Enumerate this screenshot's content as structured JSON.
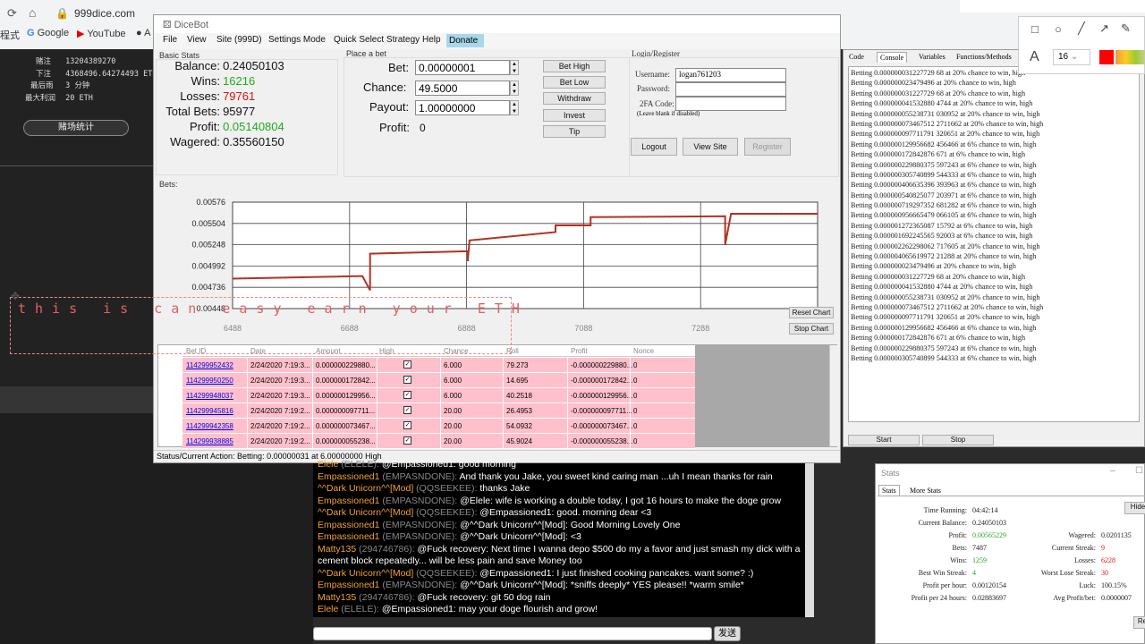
{
  "browser": {
    "url": "999dice.com",
    "left_cut": "程式",
    "bookmarks": [
      "Google",
      "YouTube",
      "A"
    ]
  },
  "site": {
    "stats": [
      {
        "label": "赌注",
        "value": "13204389270"
      },
      {
        "label": "下注",
        "value": "4368496.64274493 ETH"
      },
      {
        "label": "最后雨",
        "value": "3 分钟"
      },
      {
        "label": "最大利润",
        "value": "20 ETH"
      }
    ],
    "stats_button": "赌场统计"
  },
  "dicebot": {
    "title": "DiceBot",
    "menu": [
      "File",
      "View",
      "Site (999D)",
      "Settings Mode",
      "Quick Select Strategy",
      "Help",
      "Donate"
    ],
    "basic_stats_title": "Basic Stats",
    "basic_stats": [
      {
        "label": "Balance:",
        "value": "0.24050103",
        "color": "#111111"
      },
      {
        "label": "Wins:",
        "value": "16216",
        "color": "#22aa22"
      },
      {
        "label": "Losses:",
        "value": "79761",
        "color": "#dd1111"
      },
      {
        "label": "Total Bets:",
        "value": "95977",
        "color": "#111111"
      },
      {
        "label": "Profit:",
        "value": "0.05140804",
        "color": "#22aa22"
      },
      {
        "label": "Wagered:",
        "value": "0.35560150",
        "color": "#111111"
      }
    ],
    "place_bet_title": "Place a bet",
    "bet_label": "Bet:",
    "bet_value": "0.00000001",
    "chance_label": "Chance:",
    "chance_value": "49.5000",
    "payout_label": "Payout:",
    "payout_value": "1.00000000",
    "profit_label": "Profit:",
    "profit_value": "0",
    "bet_buttons": [
      "Bet High",
      "Bet Low",
      "Withdraw",
      "Invest",
      "Tip"
    ],
    "login_title": "Login/Register",
    "username_label": "Username:",
    "username_value": "logan761203",
    "password_label": "Password:",
    "twofa_label": "2FA Code:",
    "twofa_hint": "(Leave blank if disabled)",
    "logout": "Logout",
    "view_site": "View Site",
    "register": "Register",
    "bets_label": "Bets:",
    "reset_chart": "Reset Chart",
    "stop_chart": "Stop Chart",
    "table_headers": [
      "Bet ID",
      "Date",
      "Amount",
      "High",
      "Chance",
      "Roll",
      "Profit",
      "Nonce"
    ],
    "table_rows": [
      {
        "id": "114299952432",
        "date": "2/24/2020 7:19:3...",
        "amount": "0.000000229880...",
        "high": true,
        "chance": "6.000",
        "roll": "79.273",
        "profit": "-0.000000229880...",
        "nonce": "0"
      },
      {
        "id": "114299950250",
        "date": "2/24/2020 7:19:3...",
        "amount": "0.000000172842...",
        "high": true,
        "chance": "6.000",
        "roll": "14.695",
        "profit": "-0.000000172842...",
        "nonce": "0"
      },
      {
        "id": "114299948037",
        "date": "2/24/2020 7:19:3...",
        "amount": "0.000000129956...",
        "high": true,
        "chance": "6.000",
        "roll": "40.2518",
        "profit": "-0.000000129956...",
        "nonce": "0"
      },
      {
        "id": "114299945816",
        "date": "2/24/2020 7:19:2...",
        "amount": "0.000000097711...",
        "high": true,
        "chance": "20.00",
        "roll": "26.4953",
        "profit": "-0.000000097711...",
        "nonce": "0"
      },
      {
        "id": "114299942358",
        "date": "2/24/2020 7:19:2...",
        "amount": "0.000000073467...",
        "high": true,
        "chance": "20.00",
        "roll": "54.0932",
        "profit": "-0.000000073467...",
        "nonce": "0"
      },
      {
        "id": "114299938885",
        "date": "2/24/2020 7:19:2...",
        "amount": "0.000000055238...",
        "high": true,
        "chance": "20.00",
        "roll": "45.9024",
        "profit": "-0.000000055238...",
        "nonce": "0"
      }
    ],
    "status": "Status/Current Action:   Betting: 0.00000031 at 6.00000000 High"
  },
  "chart_data": {
    "type": "line",
    "title": "",
    "xlabel": "",
    "ylabel": "",
    "y_ticks": [
      "0.00576",
      "0.005504",
      "0.005248",
      "0.004992",
      "0.004736",
      "0.00448"
    ],
    "x_ticks": [
      "6488",
      "6688",
      "6888",
      "7088",
      "7288"
    ],
    "xlim": [
      6488,
      7488
    ],
    "ylim": [
      0.00448,
      0.00576
    ],
    "series": [
      {
        "x": [
          6488,
          6700,
          6710,
          6723,
          6723,
          6890,
          6890,
          6893,
          7040,
          7040,
          7100,
          7100,
          7330,
          7330,
          7340,
          7488
        ],
        "y": [
          0.00484,
          0.00487,
          0.00487,
          0.0047,
          0.00514,
          0.00517,
          0.00505,
          0.0053,
          0.0054,
          0.00548,
          0.00548,
          0.00558,
          0.00559,
          0.00525,
          0.00562,
          0.00562
        ]
      }
    ],
    "grid": true
  },
  "console": {
    "tabs": [
      "Code",
      "Console",
      "Variables",
      "Functions/Methods"
    ],
    "lines": [
      "Betting 0.000000031227729 68 at 20% chance to win, high",
      "Betting 0.000000023479496 at 20% chance to win, high",
      "Betting 0.000000031227729 68 at 20% chance to win, high",
      "Betting 0.000000041532880 4744 at 20% chance to win, high",
      "Betting 0.000000055238731 030952 at 20% chance to win, high",
      "Betting 0.000000073467512 2711662 at 20% chance to win, high",
      "Betting 0.000000097711791 320651 at 20% chance to win, high",
      "Betting 0.000000129956682 456466 at 6% chance to win, high",
      "Betting 0.000000172842876 671 at 6% chance to win, high",
      "Betting 0.000000229880375 597243 at 6% chance to win, high",
      "Betting 0.000000305740899 544333 at 6% chance to win, high",
      "Betting 0.000000406635396 393963 at 6% chance to win, high",
      "Betting 0.000000540825077 203971 at 6% chance to win, high",
      "Betting 0.000000719297352 681282 at 6% chance to win, high",
      "Betting 0.000000956665479 066105 at 6% chance to win, high",
      "Betting 0.000001272365087 15792 at 6% chance to win, high",
      "Betting 0.000001692245565 92003 at 6% chance to win, high",
      "Betting 0.000002262298062 717605 at 20% chance to win, high",
      "Betting 0.000004065619972 21288 at 20% chance to win, high",
      "Betting 0.000000023479496 at 20% chance to win, high",
      "Betting 0.000000031227729 68 at 20% chance to win, high",
      "Betting 0.000000041532880 4744 at 20% chance to win, high",
      "Betting 0.000000055238731 030952 at 20% chance to win, high",
      "Betting 0.000000073467512 2711662 at 20% chance to win, high",
      "Betting 0.000000097711791 320651 at 20% chance to win, high",
      "Betting 0.000000129956682 456466 at 6% chance to win, high",
      "Betting 0.000000172842876 671 at 6% chance to win, high",
      "Betting 0.000000229880375 597243 at 6% chance to win, high",
      "Betting 0.000000305740899 544333 at 6% chance to win, high"
    ],
    "start": "Start",
    "stop": "Stop"
  },
  "chat": {
    "messages": [
      {
        "user": "Elele",
        "id": "(ELELE):",
        "text": "@Empassioned1: good morning"
      },
      {
        "user": "Empassioned1",
        "id": "(EMPASNDONE):",
        "text": "And thank you Jake, you sweet kind caring man ...uh I mean thanks for rain"
      },
      {
        "user": "^^Dark Unicorn^^[Mod]",
        "id": "(QQSEEKEE):",
        "text": "thanks Jake"
      },
      {
        "user": "Empassioned1",
        "id": "(EMPASNDONE):",
        "text": "@Elele: wife is working a double today, I got 16 hours to make the doge grow"
      },
      {
        "user": "^^Dark Unicorn^^[Mod]",
        "id": "(QQSEEKEE):",
        "text": "@Empassioned1: good. morning dear <3"
      },
      {
        "user": "Empassioned1",
        "id": "(EMPASNDONE):",
        "text": "@^^Dark Unicorn^^[Mod]: Good Morning Lovely One"
      },
      {
        "user": "Empassioned1",
        "id": "(EMPASNDONE):",
        "text": "@^^Dark Unicorn^^[Mod]: <3"
      },
      {
        "user": "Matty135",
        "id": "(294746786):",
        "text": "@Fuck recovery: Next time I wanna depo $500 do my a favor and just smash my dick with a"
      },
      {
        "user": "",
        "id": "",
        "text": "cement block repeatedly... will be less pain and save Money too"
      },
      {
        "user": "^^Dark Unicorn^^[Mod]",
        "id": "(QQSEEKEE):",
        "text": "@Empassioned1: I just finished cooking pancakes. want some? :)"
      },
      {
        "user": "Empassioned1",
        "id": "(EMPASNDONE):",
        "text": "@^^Dark Unicorn^^[Mod]: *sniffs deeply* YES please!! *warm smile*"
      },
      {
        "user": "Matty135",
        "id": "(294746786):",
        "text": "@Fuck recovery: git 50 dog rain"
      },
      {
        "user": "Elele",
        "id": "(ELELE):",
        "text": "@Empassioned1: may your doge flourish and grow!"
      }
    ],
    "send": "发送"
  },
  "stats_win": {
    "title": "Stats",
    "tabs": [
      "Stats",
      "More Stats"
    ],
    "hide": "Hide",
    "reset": "Re",
    "left": [
      {
        "label": "Time Running:",
        "value": "04:42:14",
        "color": "#222222"
      },
      {
        "label": "Current Balance:",
        "value": "0.24050103",
        "color": "#222222"
      },
      {
        "label": "Profit:",
        "value": "0.00565229",
        "color": "#22aa22"
      },
      {
        "label": "Bets:",
        "value": "7487",
        "color": "#222222"
      },
      {
        "label": "Wins:",
        "value": "1259",
        "color": "#22aa22"
      },
      {
        "label": "Best Win Streak:",
        "value": "4",
        "color": "#22aa22"
      },
      {
        "label": "Profit per hour:",
        "value": "0.00120154",
        "color": "#222222"
      },
      {
        "label": "Profit per 24 hours:",
        "value": "0.02883697",
        "color": "#222222"
      }
    ],
    "right": [
      {
        "label": "Wagered:",
        "value": "0.0201135",
        "color": "#222222"
      },
      {
        "label": "Current Streak:",
        "value": "9",
        "color": "#dd1111"
      },
      {
        "label": "Losses:",
        "value": "6228",
        "color": "#dd1111"
      },
      {
        "label": "Worst Lose Streak:",
        "value": "30",
        "color": "#dd1111"
      },
      {
        "label": "Luck:",
        "value": "100.15%",
        "color": "#222222"
      },
      {
        "label": "Avg Profit/bet:",
        "value": "0.0000007",
        "color": "#222222"
      }
    ]
  },
  "annotation": {
    "font_size": "16",
    "overlay_text": "this is can easy earn your ETH"
  }
}
